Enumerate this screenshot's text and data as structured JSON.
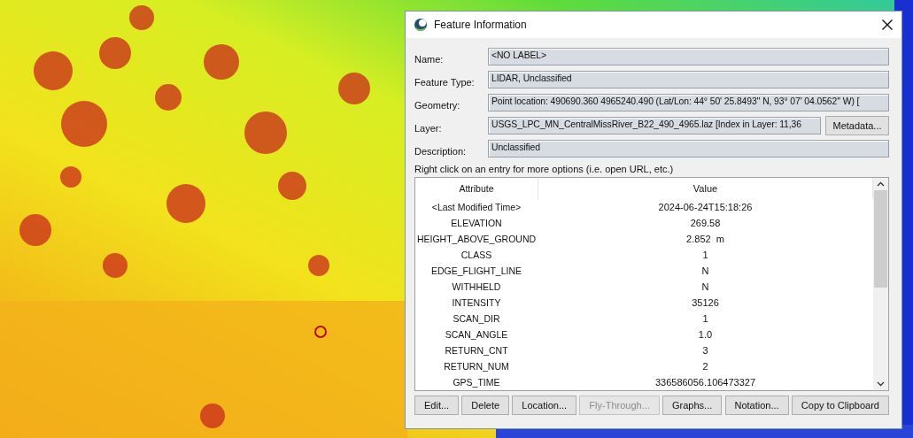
{
  "window": {
    "title": "Feature Information"
  },
  "fields": [
    {
      "label": "Name:",
      "value": "<NO LABEL>"
    },
    {
      "label": "Feature Type:",
      "value": "LIDAR, Unclassified"
    },
    {
      "label": "Geometry:",
      "value": "Point location: 490690.360 4965240.490 (Lat/Lon: 44° 50' 25.8493'' N, 93° 07' 04.0562'' W) ["
    },
    {
      "label": "Layer:",
      "value": "USGS_LPC_MN_CentralMissRiver_B22_490_4965.laz [Index in Layer: 11,36",
      "button": "Metadata..."
    },
    {
      "label": "Description:",
      "value": "Unclassified"
    }
  ],
  "hint": "Right click on an entry for more options (i.e. open URL, etc.)",
  "table": {
    "columns": [
      "Attribute",
      "Value"
    ],
    "rows": [
      [
        "<Last Modified Time>",
        "2024-06-24T15:18:26"
      ],
      [
        "ELEVATION",
        "269.58"
      ],
      [
        "HEIGHT_ABOVE_GROUND",
        "2.852  m"
      ],
      [
        "CLASS",
        "1"
      ],
      [
        "EDGE_FLIGHT_LINE",
        "N"
      ],
      [
        "WITHHELD",
        "N"
      ],
      [
        "INTENSITY",
        "35126"
      ],
      [
        "SCAN_DIR",
        "1"
      ],
      [
        "SCAN_ANGLE",
        "1.0"
      ],
      [
        "RETURN_CNT",
        "3"
      ],
      [
        "RETURN_NUM",
        "2"
      ],
      [
        "GPS_TIME",
        "336586056.106473327"
      ]
    ]
  },
  "buttons": [
    {
      "label": "Edit...",
      "disabled": false
    },
    {
      "label": "Delete",
      "disabled": false
    },
    {
      "label": "Location...",
      "disabled": false
    },
    {
      "label": "Fly-Through...",
      "disabled": true
    },
    {
      "label": "Graphs...",
      "disabled": false
    },
    {
      "label": "Notation...",
      "disabled": false
    },
    {
      "label": "Copy to Clipboard",
      "disabled": false
    }
  ]
}
